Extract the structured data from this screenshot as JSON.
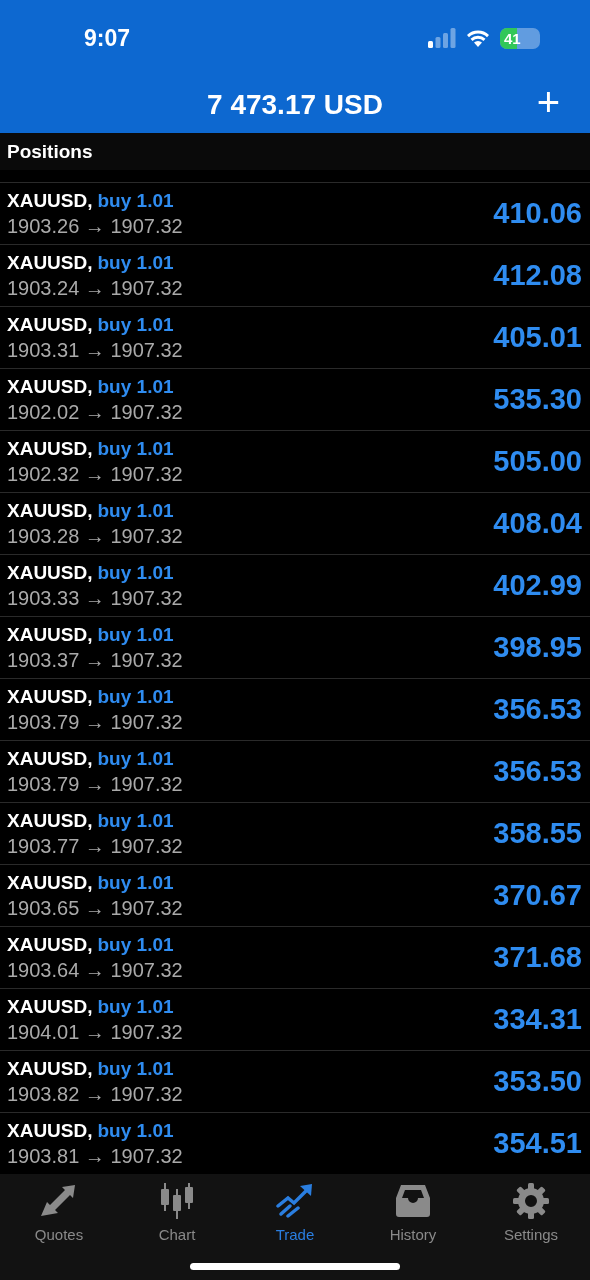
{
  "status_bar": {
    "time": "9:07",
    "battery": "41"
  },
  "header": {
    "title": "7 473.17 USD",
    "add_button": "+"
  },
  "section": {
    "title": "Positions"
  },
  "positions": [
    {
      "symbol": "XAUUSD,",
      "order": "buy 1.01",
      "prices": "1903.26 → 1907.32",
      "profit": "410.06"
    },
    {
      "symbol": "XAUUSD,",
      "order": "buy 1.01",
      "prices": "1903.24 → 1907.32",
      "profit": "412.08"
    },
    {
      "symbol": "XAUUSD,",
      "order": "buy 1.01",
      "prices": "1903.31 → 1907.32",
      "profit": "405.01"
    },
    {
      "symbol": "XAUUSD,",
      "order": "buy 1.01",
      "prices": "1902.02 → 1907.32",
      "profit": "535.30"
    },
    {
      "symbol": "XAUUSD,",
      "order": "buy 1.01",
      "prices": "1902.32 → 1907.32",
      "profit": "505.00"
    },
    {
      "symbol": "XAUUSD,",
      "order": "buy 1.01",
      "prices": "1903.28 → 1907.32",
      "profit": "408.04"
    },
    {
      "symbol": "XAUUSD,",
      "order": "buy 1.01",
      "prices": "1903.33 → 1907.32",
      "profit": "402.99"
    },
    {
      "symbol": "XAUUSD,",
      "order": "buy 1.01",
      "prices": "1903.37 → 1907.32",
      "profit": "398.95"
    },
    {
      "symbol": "XAUUSD,",
      "order": "buy 1.01",
      "prices": "1903.79 → 1907.32",
      "profit": "356.53"
    },
    {
      "symbol": "XAUUSD,",
      "order": "buy 1.01",
      "prices": "1903.79 → 1907.32",
      "profit": "356.53"
    },
    {
      "symbol": "XAUUSD,",
      "order": "buy 1.01",
      "prices": "1903.77 → 1907.32",
      "profit": "358.55"
    },
    {
      "symbol": "XAUUSD,",
      "order": "buy 1.01",
      "prices": "1903.65 → 1907.32",
      "profit": "370.67"
    },
    {
      "symbol": "XAUUSD,",
      "order": "buy 1.01",
      "prices": "1903.64 → 1907.32",
      "profit": "371.68"
    },
    {
      "symbol": "XAUUSD,",
      "order": "buy 1.01",
      "prices": "1904.01 → 1907.32",
      "profit": "334.31"
    },
    {
      "symbol": "XAUUSD,",
      "order": "buy 1.01",
      "prices": "1903.82 → 1907.32",
      "profit": "353.50"
    },
    {
      "symbol": "XAUUSD,",
      "order": "buy 1.01",
      "prices": "1903.81 → 1907.32",
      "profit": "354.51"
    }
  ],
  "tabs": [
    {
      "label": "Quotes",
      "selected": false
    },
    {
      "label": "Chart",
      "selected": false
    },
    {
      "label": "Trade",
      "selected": true
    },
    {
      "label": "History",
      "selected": false
    },
    {
      "label": "Settings",
      "selected": false
    }
  ]
}
